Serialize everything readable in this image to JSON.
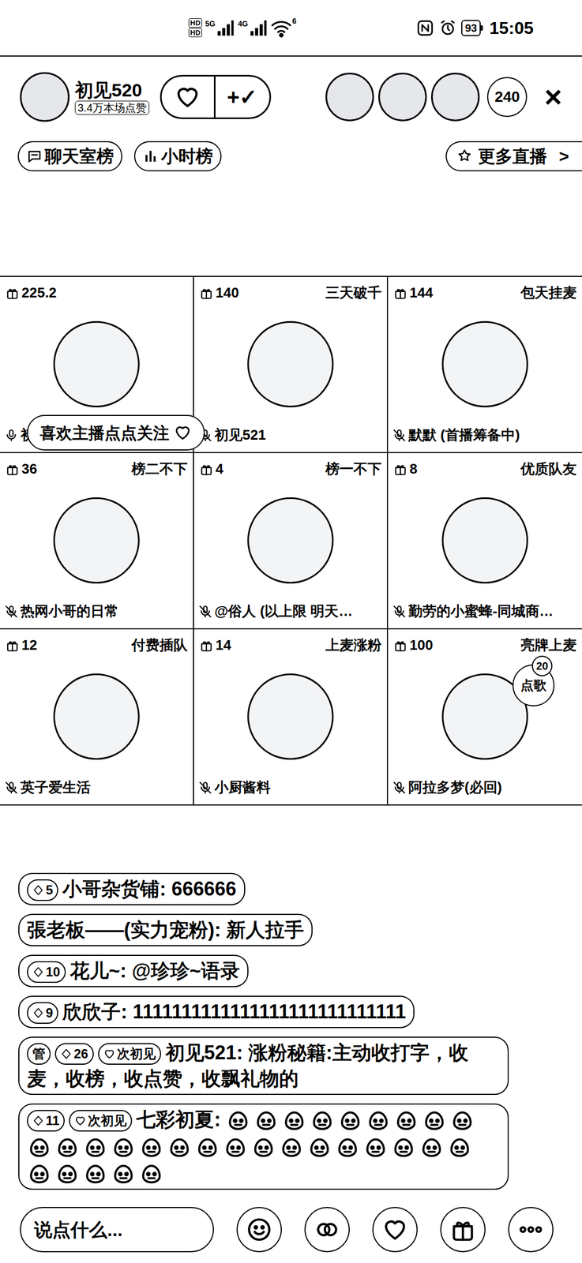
{
  "status_bar": {
    "hd": [
      "HD",
      "HD"
    ],
    "networks": [
      "5G",
      "4G"
    ],
    "wifi": "6",
    "battery": "93",
    "time": "15:05"
  },
  "host": {
    "name": "初见520",
    "likes": "3.4万本场点赞",
    "follow": "+✓"
  },
  "viewers": {
    "count": "240"
  },
  "close": "×",
  "tabs": [
    {
      "label": "聊天室榜"
    },
    {
      "label": "小时榜"
    }
  ],
  "more_live": {
    "label": "更多直播",
    "arrow": ">"
  },
  "seats": [
    {
      "gifts": "225.2",
      "tag": "",
      "name": "初见520",
      "muted": false
    },
    {
      "gifts": "140",
      "tag": "三天破千",
      "name": "初见521",
      "muted": true
    },
    {
      "gifts": "144",
      "tag": "包天挂麦",
      "name": "默默 (首播筹备中)",
      "muted": true
    },
    {
      "gifts": "36",
      "tag": "榜二不下",
      "name": "热网小哥的日常",
      "muted": true
    },
    {
      "gifts": "4",
      "tag": "榜一不下",
      "name": "@俗人 (以上限 明天…",
      "muted": true
    },
    {
      "gifts": "8",
      "tag": "优质队友",
      "name": "勤劳的小蜜蜂-同城商…",
      "muted": true
    },
    {
      "gifts": "12",
      "tag": "付费插队",
      "name": "英子爱生活",
      "muted": true
    },
    {
      "gifts": "14",
      "tag": "上麦涨粉",
      "name": "小厨酱料",
      "muted": true
    },
    {
      "gifts": "100",
      "tag": "亮牌上麦",
      "name": "阿拉多梦(必回)",
      "muted": true
    }
  ],
  "song_request": {
    "count": "20",
    "label": "点歌"
  },
  "tooltip": "喜欢主播点点关注",
  "chat": [
    {
      "badges": [
        {
          "kind": "level",
          "text": "5"
        }
      ],
      "user": "小哥杂货铺:",
      "text": "666666",
      "stickers": 0
    },
    {
      "badges": [],
      "user": "張老板——(实力宠粉):",
      "text": "新人拉手",
      "stickers": 0
    },
    {
      "badges": [
        {
          "kind": "level",
          "text": "10"
        }
      ],
      "user": "花儿~:",
      "text": "@珍珍~语录",
      "stickers": 0
    },
    {
      "badges": [
        {
          "kind": "level",
          "text": "9"
        }
      ],
      "user": "欣欣子:",
      "text": "1111111111111111111111111111",
      "stickers": 0
    },
    {
      "badges": [
        {
          "kind": "admin",
          "text": "管"
        },
        {
          "kind": "level",
          "text": "26"
        },
        {
          "kind": "fan",
          "text": "次初见"
        }
      ],
      "user": "初见521:",
      "text": "涨粉秘籍:主动收打字，收麦，收榜，收点赞，收飘礼物的",
      "stickers": 0
    },
    {
      "badges": [
        {
          "kind": "level",
          "text": "11"
        },
        {
          "kind": "fan",
          "text": "次初见"
        }
      ],
      "user": "七彩初夏:",
      "text": "",
      "stickers": 30
    }
  ],
  "input": {
    "placeholder": "说点什么..."
  }
}
